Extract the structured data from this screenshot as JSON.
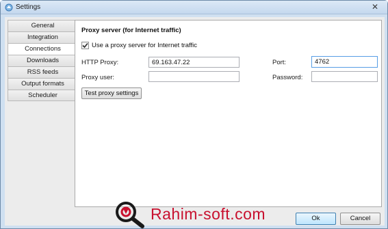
{
  "window": {
    "title": "Settings"
  },
  "sidebar": {
    "tabs": [
      {
        "label": "General"
      },
      {
        "label": "Integration"
      },
      {
        "label": "Connections"
      },
      {
        "label": "Downloads"
      },
      {
        "label": "RSS feeds"
      },
      {
        "label": "Output formats"
      },
      {
        "label": "Scheduler"
      }
    ],
    "active": "Connections"
  },
  "proxy": {
    "section_title": "Proxy server (for Internet traffic)",
    "use_proxy_label": "Use a proxy server for Internet traffic",
    "use_proxy_checked": true,
    "http_proxy_label": "HTTP Proxy:",
    "http_proxy_value": "69.163.47.22",
    "port_label": "Port:",
    "port_value": "4762",
    "user_label": "Proxy user:",
    "user_value": "",
    "password_label": "Password:",
    "password_value": "",
    "test_button": "Test proxy settings"
  },
  "footer": {
    "ok": "Ok",
    "cancel": "Cancel"
  },
  "watermark": {
    "text": "Rahim-soft.com"
  },
  "colors": {
    "watermark": "#c8102e",
    "focus_border": "#569de5"
  }
}
